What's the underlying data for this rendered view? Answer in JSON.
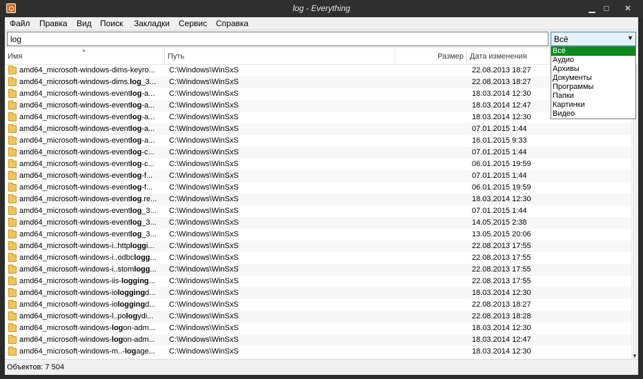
{
  "window": {
    "title": "log - Everything"
  },
  "menu": {
    "items": [
      "Файл",
      "Правка",
      "Вид",
      "Поиск",
      "Закладки",
      "Сервис",
      "Справка"
    ]
  },
  "search": {
    "value": "log"
  },
  "filter": {
    "selected": "Всё",
    "options": [
      "Всё",
      "Аудио",
      "Архивы",
      "Документы",
      "Программы",
      "Папки",
      "Картинки",
      "Видео"
    ]
  },
  "columns": {
    "name": "Имя",
    "path": "Путь",
    "size": "Размер",
    "date": "Дата изменения"
  },
  "rows": [
    {
      "pre": "amd64_microsoft-windows-dims-keyro...",
      "hl": "",
      "post": "",
      "path": "C:\\Windows\\WinSxS",
      "date": "22.08.2013 18:27"
    },
    {
      "pre": "amd64_microsoft-windows-dims.",
      "hl": "log",
      "post": "_3...",
      "path": "C:\\Windows\\WinSxS",
      "date": "22.08.2013 18:27"
    },
    {
      "pre": "amd64_microsoft-windows-event",
      "hl": "log",
      "post": "-a...",
      "path": "C:\\Windows\\WinSxS",
      "date": "18.03.2014 12:30"
    },
    {
      "pre": "amd64_microsoft-windows-event",
      "hl": "log",
      "post": "-a...",
      "path": "C:\\Windows\\WinSxS",
      "date": "18.03.2014 12:47"
    },
    {
      "pre": "amd64_microsoft-windows-event",
      "hl": "log",
      "post": "-a...",
      "path": "C:\\Windows\\WinSxS",
      "date": "18.03.2014 12:30"
    },
    {
      "pre": "amd64_microsoft-windows-event",
      "hl": "log",
      "post": "-a...",
      "path": "C:\\Windows\\WinSxS",
      "date": "07.01.2015 1:44"
    },
    {
      "pre": "amd64_microsoft-windows-event",
      "hl": "log",
      "post": "-a...",
      "path": "C:\\Windows\\WinSxS",
      "date": "16.01.2015 9:33"
    },
    {
      "pre": "amd64_microsoft-windows-event",
      "hl": "log",
      "post": "-c...",
      "path": "C:\\Windows\\WinSxS",
      "date": "07.01.2015 1:44"
    },
    {
      "pre": "amd64_microsoft-windows-event",
      "hl": "log",
      "post": "-c...",
      "path": "C:\\Windows\\WinSxS",
      "date": "06.01.2015 19:59"
    },
    {
      "pre": "amd64_microsoft-windows-event",
      "hl": "log",
      "post": "-f...",
      "path": "C:\\Windows\\WinSxS",
      "date": "07.01.2015 1:44"
    },
    {
      "pre": "amd64_microsoft-windows-event",
      "hl": "log",
      "post": "-f...",
      "path": "C:\\Windows\\WinSxS",
      "date": "06.01.2015 19:59"
    },
    {
      "pre": "amd64_microsoft-windows-event",
      "hl": "log",
      "post": ".re...",
      "path": "C:\\Windows\\WinSxS",
      "date": "18.03.2014 12:30"
    },
    {
      "pre": "amd64_microsoft-windows-event",
      "hl": "log",
      "post": "_3...",
      "path": "C:\\Windows\\WinSxS",
      "date": "07.01.2015 1:44"
    },
    {
      "pre": "amd64_microsoft-windows-event",
      "hl": "log",
      "post": "_3...",
      "path": "C:\\Windows\\WinSxS",
      "date": "14.05.2015 2:38"
    },
    {
      "pre": "amd64_microsoft-windows-event",
      "hl": "log",
      "post": "_3...",
      "path": "C:\\Windows\\WinSxS",
      "date": "13.05.2015 20:06"
    },
    {
      "pre": "amd64_microsoft-windows-i..http",
      "hl": "logg",
      "post": "i...",
      "path": "C:\\Windows\\WinSxS",
      "date": "22.08.2013 17:55"
    },
    {
      "pre": "amd64_microsoft-windows-i..odbc",
      "hl": "logg",
      "post": "...",
      "path": "C:\\Windows\\WinSxS",
      "date": "22.08.2013 17:55"
    },
    {
      "pre": "amd64_microsoft-windows-i..stom",
      "hl": "logg",
      "post": "...",
      "path": "C:\\Windows\\WinSxS",
      "date": "22.08.2013 17:55"
    },
    {
      "pre": "amd64_microsoft-windows-iis-",
      "hl": "logging",
      "post": "...",
      "path": "C:\\Windows\\WinSxS",
      "date": "22.08.2013 17:55"
    },
    {
      "pre": "amd64_microsoft-windows-io",
      "hl": "logging",
      "post": "d...",
      "path": "C:\\Windows\\WinSxS",
      "date": "18.03.2014 12:30"
    },
    {
      "pre": "amd64_microsoft-windows-io",
      "hl": "logging",
      "post": "d...",
      "path": "C:\\Windows\\WinSxS",
      "date": "22.08.2013 18:27"
    },
    {
      "pre": "amd64_microsoft-windows-l..po",
      "hl": "log",
      "post": "ydi...",
      "path": "C:\\Windows\\WinSxS",
      "date": "22.08.2013 18:28"
    },
    {
      "pre": "amd64_microsoft-windows-",
      "hl": "log",
      "post": "on-adm...",
      "path": "C:\\Windows\\WinSxS",
      "date": "18.03.2014 12:30"
    },
    {
      "pre": "amd64_microsoft-windows-",
      "hl": "log",
      "post": "on-adm...",
      "path": "C:\\Windows\\WinSxS",
      "date": "18.03.2014 12:47"
    },
    {
      "pre": "amd64_microsoft-windows-m..-",
      "hl": "log",
      "post": "age...",
      "path": "C:\\Windows\\WinSxS",
      "date": "18.03.2014 12:30"
    }
  ],
  "status": {
    "text": "Объектов: 7 504"
  },
  "colors": {
    "dropdown_selected": "#0b8a1e",
    "titlebar": "#2f2f2f",
    "folder": "#f2c554"
  }
}
